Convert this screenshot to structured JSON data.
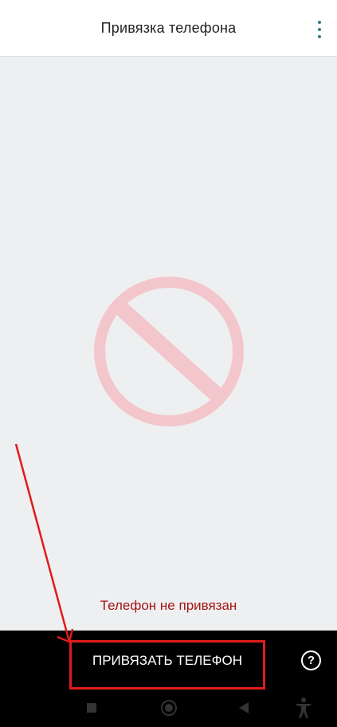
{
  "header": {
    "title": "Привязка телефона",
    "menu_icon": "more-vert-icon"
  },
  "main": {
    "status_icon": "no-entry-icon",
    "status_text": "Телефон не привязан"
  },
  "bottom": {
    "bind_button_label": "ПРИВЯЗАТЬ ТЕЛЕФОН",
    "help_label": "?"
  },
  "colors": {
    "status_text": "#a31515",
    "no_entry_icon": "#f3c6cb",
    "annotation": "#e01b1b",
    "menu_dots": "#2f7f86"
  },
  "navbar": {
    "icons": [
      "recent-apps-icon",
      "home-icon",
      "back-icon",
      "accessibility-icon"
    ]
  }
}
